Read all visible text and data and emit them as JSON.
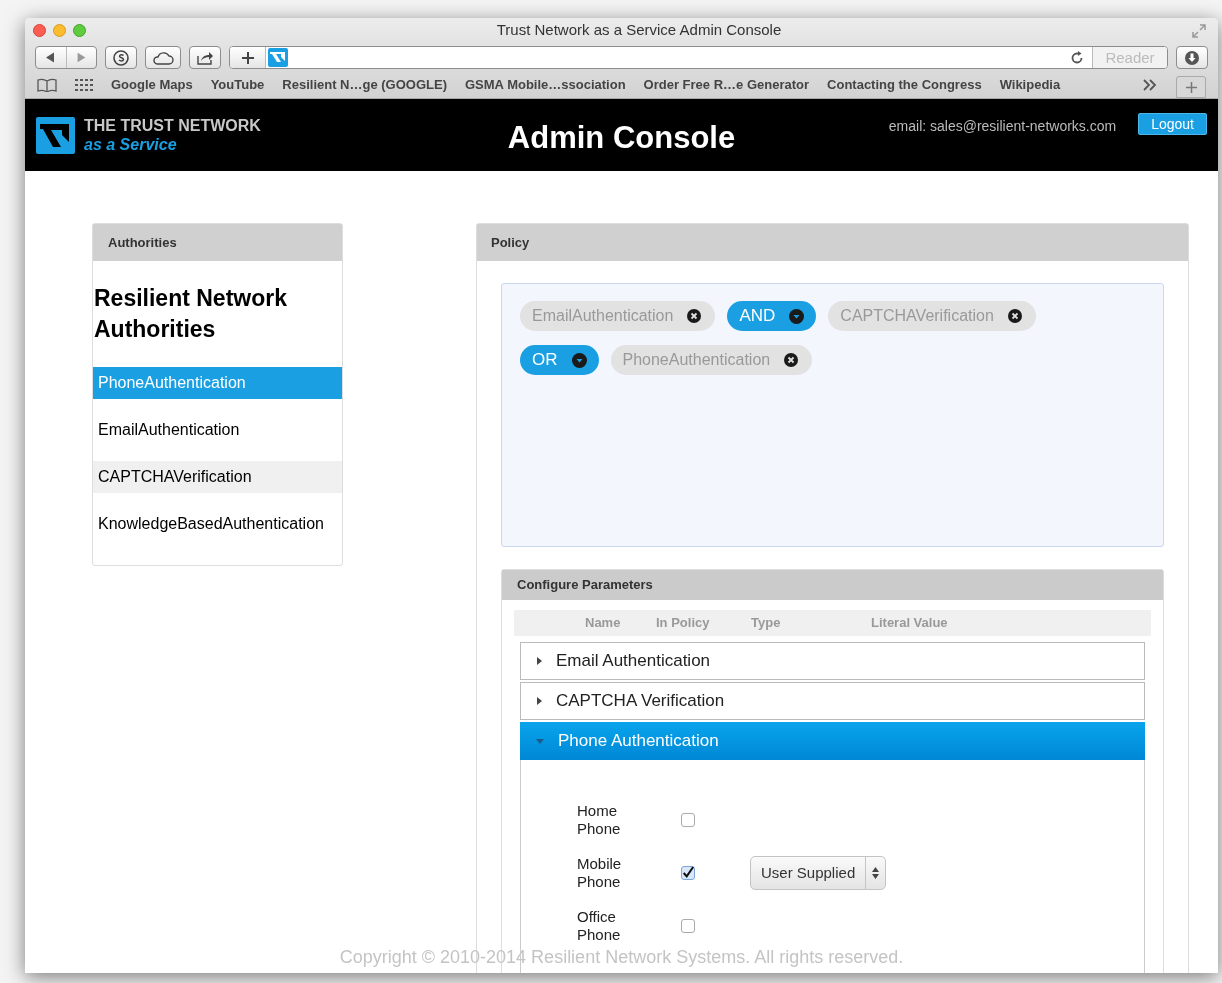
{
  "window": {
    "title": "Trust Network as a Service Admin Console"
  },
  "toolbar": {
    "reader": "Reader"
  },
  "bookmarks": [
    "Google Maps",
    "YouTube",
    "Resilient N…ge (GOOGLE)",
    "GSMA Mobile…ssociation",
    "Order Free R…e Generator",
    "Contacting the Congress",
    "Wikipedia"
  ],
  "header": {
    "logo_line_1": "THE TRUST NETWORK",
    "logo_line_2": "as a Service",
    "title": "Admin Console",
    "email": "email: sales@resilient-networks.com",
    "logout": "Logout"
  },
  "authorities": {
    "panel_title": "Authorities",
    "heading": "Resilient Network Authorities",
    "items": [
      {
        "label": "PhoneAuthentication",
        "selected": true,
        "highlighted": false
      },
      {
        "label": "EmailAuthentication",
        "selected": false,
        "highlighted": false
      },
      {
        "label": "CAPTCHAVerification",
        "selected": false,
        "highlighted": true
      },
      {
        "label": "KnowledgeBasedAuthentication",
        "selected": false,
        "highlighted": false
      }
    ]
  },
  "policy": {
    "panel_title": "Policy",
    "tokens": [
      {
        "kind": "term",
        "label": "EmailAuthentication"
      },
      {
        "kind": "operator",
        "label": "AND"
      },
      {
        "kind": "term",
        "label": "CAPTCHAVerification"
      },
      {
        "kind": "operator",
        "label": "OR"
      },
      {
        "kind": "term",
        "label": "PhoneAuthentication"
      }
    ]
  },
  "configure": {
    "panel_title": "Configure Parameters",
    "columns": [
      "Name",
      "In Policy",
      "Type",
      "Literal Value"
    ],
    "sections": [
      {
        "title": "Email Authentication",
        "expanded": false
      },
      {
        "title": "CAPTCHA Verification",
        "expanded": false
      },
      {
        "title": "Phone Authentication",
        "expanded": true,
        "rows": [
          {
            "name": "Home Phone",
            "checked": false
          },
          {
            "name": "Mobile Phone",
            "checked": true,
            "type": "User Supplied"
          },
          {
            "name": "Office Phone",
            "checked": false
          }
        ]
      }
    ]
  },
  "footer": {
    "copyright": "Copyright © 2010-2014 Resilient Network Systems. All rights reserved."
  }
}
